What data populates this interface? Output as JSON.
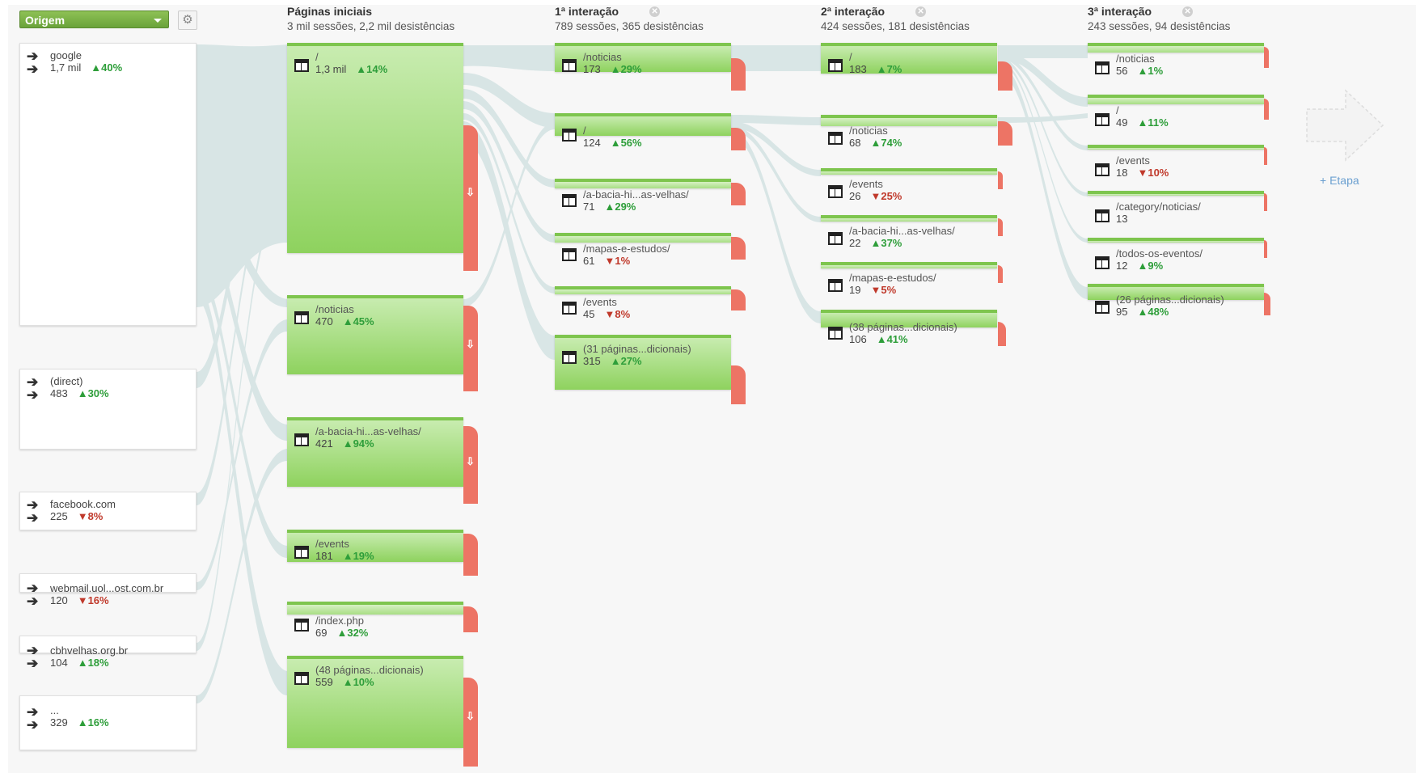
{
  "toolbar": {
    "dimension_label": "Origem"
  },
  "columns": [
    {
      "title": "Páginas iniciais",
      "subtitle": "3 mil sessões, 2,2 mil desistências"
    },
    {
      "title": "1ª interação",
      "subtitle": "789 sessões, 365 desistências"
    },
    {
      "title": "2ª interação",
      "subtitle": "424 sessões, 181 desistências"
    },
    {
      "title": "3ª interação",
      "subtitle": "243 sessões, 94 desistências"
    }
  ],
  "sources": [
    {
      "name": "google",
      "value": "1,7 mil",
      "change": "▲40%",
      "trend": "up"
    },
    {
      "name": "(direct)",
      "value": "483",
      "change": "▲30%",
      "trend": "up"
    },
    {
      "name": "facebook.com",
      "value": "225",
      "change": "▼8%",
      "trend": "down"
    },
    {
      "name": "webmail.uol...ost.com.br",
      "value": "120",
      "change": "▼16%",
      "trend": "down"
    },
    {
      "name": "cbhvelhas.org.br",
      "value": "104",
      "change": "▲18%",
      "trend": "up"
    },
    {
      "name": "...",
      "value": "329",
      "change": "▲16%",
      "trend": "up"
    }
  ],
  "landing": [
    {
      "name": "/",
      "value": "1,3 mil",
      "change": "▲14%",
      "trend": "up"
    },
    {
      "name": "/noticias",
      "value": "470",
      "change": "▲45%",
      "trend": "up"
    },
    {
      "name": "/a-bacia-hi...as-velhas/",
      "value": "421",
      "change": "▲94%",
      "trend": "up"
    },
    {
      "name": "/events",
      "value": "181",
      "change": "▲19%",
      "trend": "up"
    },
    {
      "name": "/index.php",
      "value": "69",
      "change": "▲32%",
      "trend": "up"
    },
    {
      "name": "(48 páginas...dicionais)",
      "value": "559",
      "change": "▲10%",
      "trend": "up"
    }
  ],
  "step1": [
    {
      "name": "/noticias",
      "value": "173",
      "change": "▲29%",
      "trend": "up"
    },
    {
      "name": "/",
      "value": "124",
      "change": "▲56%",
      "trend": "up"
    },
    {
      "name": "/a-bacia-hi...as-velhas/",
      "value": "71",
      "change": "▲29%",
      "trend": "up"
    },
    {
      "name": "/mapas-e-estudos/",
      "value": "61",
      "change": "▼1%",
      "trend": "down"
    },
    {
      "name": "/events",
      "value": "45",
      "change": "▼8%",
      "trend": "down"
    },
    {
      "name": "(31 páginas...dicionais)",
      "value": "315",
      "change": "▲27%",
      "trend": "up"
    }
  ],
  "step2": [
    {
      "name": "/",
      "value": "183",
      "change": "▲7%",
      "trend": "up"
    },
    {
      "name": "/noticias",
      "value": "68",
      "change": "▲74%",
      "trend": "up"
    },
    {
      "name": "/events",
      "value": "26",
      "change": "▼25%",
      "trend": "down"
    },
    {
      "name": "/a-bacia-hi...as-velhas/",
      "value": "22",
      "change": "▲37%",
      "trend": "up"
    },
    {
      "name": "/mapas-e-estudos/",
      "value": "19",
      "change": "▼5%",
      "trend": "down"
    },
    {
      "name": "(38 páginas...dicionais)",
      "value": "106",
      "change": "▲41%",
      "trend": "up"
    }
  ],
  "step3": [
    {
      "name": "/noticias",
      "value": "56",
      "change": "▲1%",
      "trend": "up"
    },
    {
      "name": "/",
      "value": "49",
      "change": "▲11%",
      "trend": "up"
    },
    {
      "name": "/events",
      "value": "18",
      "change": "▼10%",
      "trend": "down"
    },
    {
      "name": "/category/noticias/",
      "value": "13",
      "change": "",
      "trend": ""
    },
    {
      "name": "/todos-os-eventos/",
      "value": "12",
      "change": "▲9%",
      "trend": "up"
    },
    {
      "name": "(26 páginas...dicionais)",
      "value": "95",
      "change": "▲48%",
      "trend": "up"
    }
  ],
  "add_step_label": "+ Etapa",
  "colors": {
    "node_green": "#8ed25e",
    "dropoff_red": "#ed7465",
    "flow": "#d3e3e3",
    "up": "#2e9e3a",
    "down": "#c0392b"
  },
  "icons": {
    "source": "source-arrow-icon",
    "page": "page-icon",
    "dropoff": "dropoff-arrow-icon",
    "settings": "gear-icon",
    "close": "close-icon"
  }
}
